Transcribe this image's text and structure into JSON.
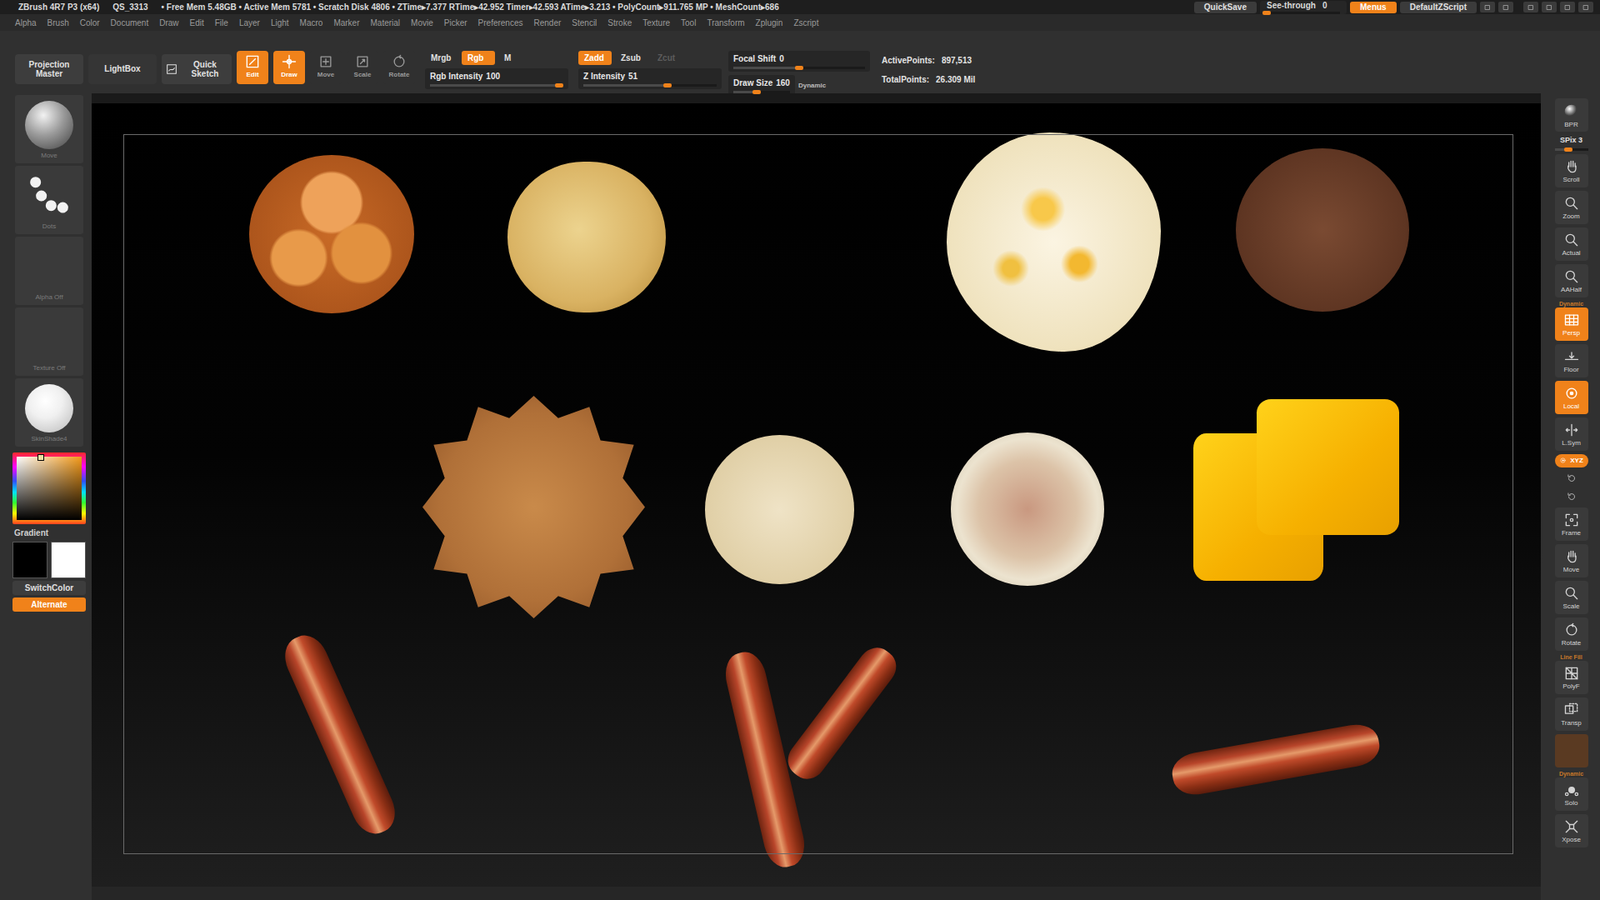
{
  "window": {
    "title": "ZBrush 4R7 P3 (x64)",
    "session": "QS_3313",
    "stats": "• Free Mem 5.48GB • Active Mem 5781 • Scratch Disk 4806 • ZTime▸7.377 RTime▸42.952 Timer▸42.593 ATime▸3.213 • PolyCount▸911.765 MP • MeshCount▸686"
  },
  "title_bar": {
    "quicksave": "QuickSave",
    "see_through": {
      "label": "See-through",
      "value": "0",
      "level": 0
    },
    "menus": {
      "label": "Menus",
      "on": true
    },
    "script": "DefaultZScript"
  },
  "menu": [
    "Alpha",
    "Brush",
    "Color",
    "Document",
    "Draw",
    "Edit",
    "File",
    "Layer",
    "Light",
    "Macro",
    "Marker",
    "Material",
    "Movie",
    "Picker",
    "Preferences",
    "Render",
    "Stencil",
    "Stroke",
    "Texture",
    "Tool",
    "Transform",
    "Zplugin",
    "Zscript"
  ],
  "shelf": {
    "projection_master": "Projection Master",
    "lightbox": "LightBox",
    "quick_sketch": "Quick Sketch",
    "modes": [
      {
        "label": "Edit",
        "on": true
      },
      {
        "label": "Draw",
        "on": true
      },
      {
        "label": "Move",
        "on": false
      },
      {
        "label": "Scale",
        "on": false
      },
      {
        "label": "Rotate",
        "on": false
      }
    ],
    "color_modes": [
      {
        "label": "Mrgb",
        "selected": false
      },
      {
        "label": "Rgb",
        "selected": true
      },
      {
        "label": "M",
        "selected": false
      }
    ],
    "rgb_intensity": {
      "label": "Rgb Intensity",
      "value": "100",
      "level": 0.97
    },
    "z_modes": [
      {
        "label": "Zadd",
        "selected": true,
        "disabled": false
      },
      {
        "label": "Zsub",
        "selected": false,
        "disabled": false
      },
      {
        "label": "Zcut",
        "selected": false,
        "disabled": true
      }
    ],
    "z_intensity": {
      "label": "Z Intensity",
      "value": "51",
      "level": 0.63
    },
    "focal_shift": {
      "label": "Focal Shift",
      "value": "0",
      "level": 0.5
    },
    "draw_size": {
      "label": "Draw Size",
      "value": "160",
      "level": 0.41
    },
    "dynamic": "Dynamic",
    "points": [
      {
        "label": "ActivePoints:",
        "value": "897,513"
      },
      {
        "label": "TotalPoints:",
        "value": "26.309 Mil"
      }
    ]
  },
  "left_shelf": {
    "thumbs": [
      {
        "label": "Move",
        "kind": "brush"
      },
      {
        "label": "Dots",
        "kind": "stroke"
      },
      {
        "label": "Alpha Off",
        "kind": "empty"
      },
      {
        "label": "Texture Off",
        "kind": "empty"
      },
      {
        "label": "SkinShade4",
        "kind": "material"
      }
    ],
    "gradient": "Gradient",
    "swatches": [
      {
        "color": "#000000"
      },
      {
        "color": "#ffffff"
      }
    ],
    "switch_color": "SwitchColor",
    "alternate": {
      "label": "Alternate",
      "on": true
    }
  },
  "right_shelf": [
    {
      "label": "BPR",
      "kind": "button",
      "on": false,
      "disabled": false
    },
    {
      "label": "SPix 3",
      "kind": "slider",
      "level": 0.4,
      "on": false,
      "disabled": false
    },
    {
      "label": "Scroll",
      "kind": "button",
      "on": false,
      "disabled": false
    },
    {
      "label": "Zoom",
      "kind": "button",
      "on": false,
      "disabled": false
    },
    {
      "label": "Actual",
      "kind": "button",
      "on": false,
      "disabled": false
    },
    {
      "label": "AAHalf",
      "kind": "button",
      "on": false,
      "disabled": false
    },
    {
      "caption": "Dynamic",
      "label": "Persp",
      "kind": "button",
      "on": true,
      "disabled": false
    },
    {
      "label": "Floor",
      "kind": "button",
      "on": false,
      "disabled": false
    },
    {
      "label": "Local",
      "kind": "button",
      "on": true,
      "disabled": false
    },
    {
      "label": "L.Sym",
      "kind": "button",
      "on": false,
      "disabled": false
    },
    {
      "label": "XYZ",
      "kind": "pill",
      "on": true,
      "disabled": false
    },
    {
      "kind": "mini",
      "on": false,
      "disabled": false
    },
    {
      "kind": "mini",
      "on": false,
      "disabled": false
    },
    {
      "label": "Frame",
      "kind": "button",
      "on": false,
      "disabled": false
    },
    {
      "label": "Move",
      "kind": "button",
      "on": false,
      "disabled": false
    },
    {
      "label": "Scale",
      "kind": "button",
      "on": false,
      "disabled": false
    },
    {
      "label": "Rotate",
      "kind": "button",
      "on": false,
      "disabled": false
    },
    {
      "caption": "Line Fill",
      "label": "PolyF",
      "kind": "button",
      "on": false,
      "disabled": false
    },
    {
      "label": "Transp",
      "kind": "button",
      "on": false,
      "disabled": false
    },
    {
      "kind": "ghost",
      "on": false,
      "disabled": true
    },
    {
      "caption": "Dynamic",
      "label": "Solo",
      "kind": "button",
      "on": false,
      "disabled": false
    },
    {
      "label": "Xpose",
      "kind": "button",
      "on": false,
      "disabled": false
    }
  ],
  "canvas": {
    "items": [
      {
        "kind": "croissant-bun"
      },
      {
        "kind": "bun"
      },
      {
        "kind": "egg"
      },
      {
        "kind": "patty"
      },
      {
        "kind": "hash-brown"
      },
      {
        "kind": "muffin-top"
      },
      {
        "kind": "muffin-bottom"
      },
      {
        "kind": "cheese"
      },
      {
        "kind": "bacon"
      },
      {
        "kind": "bacon"
      },
      {
        "kind": "bacon"
      },
      {
        "kind": "bacon"
      }
    ]
  }
}
